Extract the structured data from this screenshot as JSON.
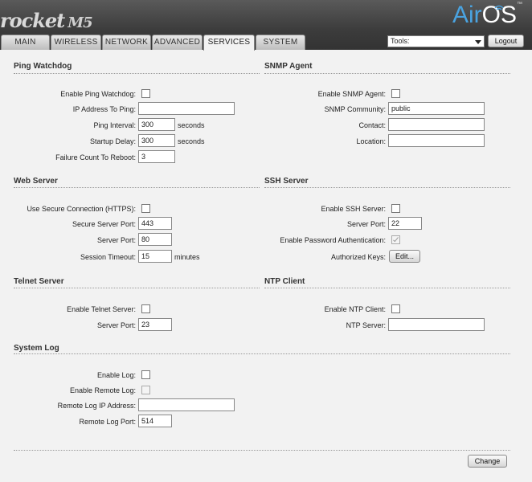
{
  "header": {
    "logo": "rocket",
    "model": "M5",
    "brand_air": "Air",
    "brand_os": "OS",
    "trademark": "™"
  },
  "tabs": [
    {
      "label": "MAIN",
      "active": false
    },
    {
      "label": "WIRELESS",
      "active": false
    },
    {
      "label": "NETWORK",
      "active": false
    },
    {
      "label": "ADVANCED",
      "active": false
    },
    {
      "label": "SERVICES",
      "active": true
    },
    {
      "label": "SYSTEM",
      "active": false
    }
  ],
  "tools": {
    "selected": "Tools:"
  },
  "logout_label": "Logout",
  "ping_watchdog": {
    "title": "Ping Watchdog",
    "enable_label": "Enable Ping Watchdog:",
    "ip_label": "IP Address To Ping:",
    "ip_value": "",
    "interval_label": "Ping Interval:",
    "interval_value": "300",
    "interval_unit": "seconds",
    "startup_label": "Startup Delay:",
    "startup_value": "300",
    "startup_unit": "seconds",
    "failure_label": "Failure Count To Reboot:",
    "failure_value": "3"
  },
  "snmp": {
    "title": "SNMP Agent",
    "enable_label": "Enable SNMP Agent:",
    "community_label": "SNMP Community:",
    "community_value": "public",
    "contact_label": "Contact:",
    "contact_value": "",
    "location_label": "Location:",
    "location_value": ""
  },
  "web_server": {
    "title": "Web Server",
    "https_label": "Use Secure Connection (HTTPS):",
    "secure_port_label": "Secure Server Port:",
    "secure_port_value": "443",
    "port_label": "Server Port:",
    "port_value": "80",
    "timeout_label": "Session Timeout:",
    "timeout_value": "15",
    "timeout_unit": "minutes"
  },
  "ssh": {
    "title": "SSH Server",
    "enable_label": "Enable SSH Server:",
    "port_label": "Server Port:",
    "port_value": "22",
    "password_label": "Enable Password Authentication:",
    "keys_label": "Authorized Keys:",
    "edit_label": "Edit..."
  },
  "telnet": {
    "title": "Telnet Server",
    "enable_label": "Enable Telnet Server:",
    "port_label": "Server Port:",
    "port_value": "23"
  },
  "ntp": {
    "title": "NTP Client",
    "enable_label": "Enable NTP Client:",
    "server_label": "NTP Server:",
    "server_value": ""
  },
  "system_log": {
    "title": "System Log",
    "enable_label": "Enable Log:",
    "remote_label": "Enable Remote Log:",
    "remote_ip_label": "Remote Log IP Address:",
    "remote_ip_value": "",
    "remote_port_label": "Remote Log Port:",
    "remote_port_value": "514"
  },
  "change_label": "Change"
}
